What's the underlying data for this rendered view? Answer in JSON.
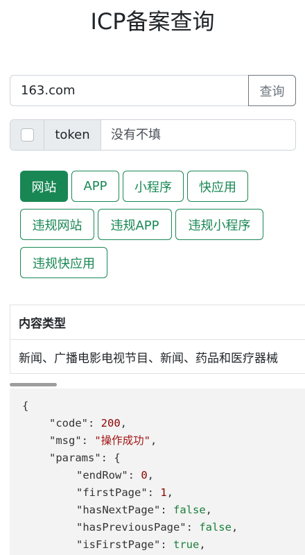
{
  "header": {
    "title": "ICP备案查询"
  },
  "search": {
    "value": "163.com",
    "button_label": "查询"
  },
  "token": {
    "label": "token",
    "placeholder": "没有不填"
  },
  "type_buttons": [
    {
      "label": "网站",
      "active": true
    },
    {
      "label": "APP",
      "active": false
    },
    {
      "label": "小程序",
      "active": false
    },
    {
      "label": "快应用",
      "active": false
    },
    {
      "label": "违规网站",
      "active": false
    },
    {
      "label": "违规APP",
      "active": false
    },
    {
      "label": "违规小程序",
      "active": false
    },
    {
      "label": "违规快应用",
      "active": false
    }
  ],
  "result_table": {
    "header": "内容类型",
    "cell": "新闻、广播电影电视节目、新闻、药品和医疗器械"
  },
  "json_view": {
    "open_brace": "{",
    "code_key": "\"code\"",
    "code_val": "200",
    "msg_key": "\"msg\"",
    "msg_val": "\"操作成功\"",
    "params_key": "\"params\"",
    "params_open": "{",
    "endRow_key": "\"endRow\"",
    "endRow_val": "0",
    "firstPage_key": "\"firstPage\"",
    "firstPage_val": "1",
    "hasNextPage_key": "\"hasNextPage\"",
    "hasNextPage_val": "false",
    "hasPreviousPage_key": "\"hasPreviousPage\"",
    "hasPreviousPage_val": "false",
    "isFirstPage_key": "\"isFirstPage\"",
    "isFirstPage_val": "true"
  },
  "colors": {
    "accent": "#198754",
    "json_number": "#8b0000",
    "json_string": "#a31515",
    "json_bool": "#1a7f3c",
    "json_bg": "#f3f3f3"
  }
}
